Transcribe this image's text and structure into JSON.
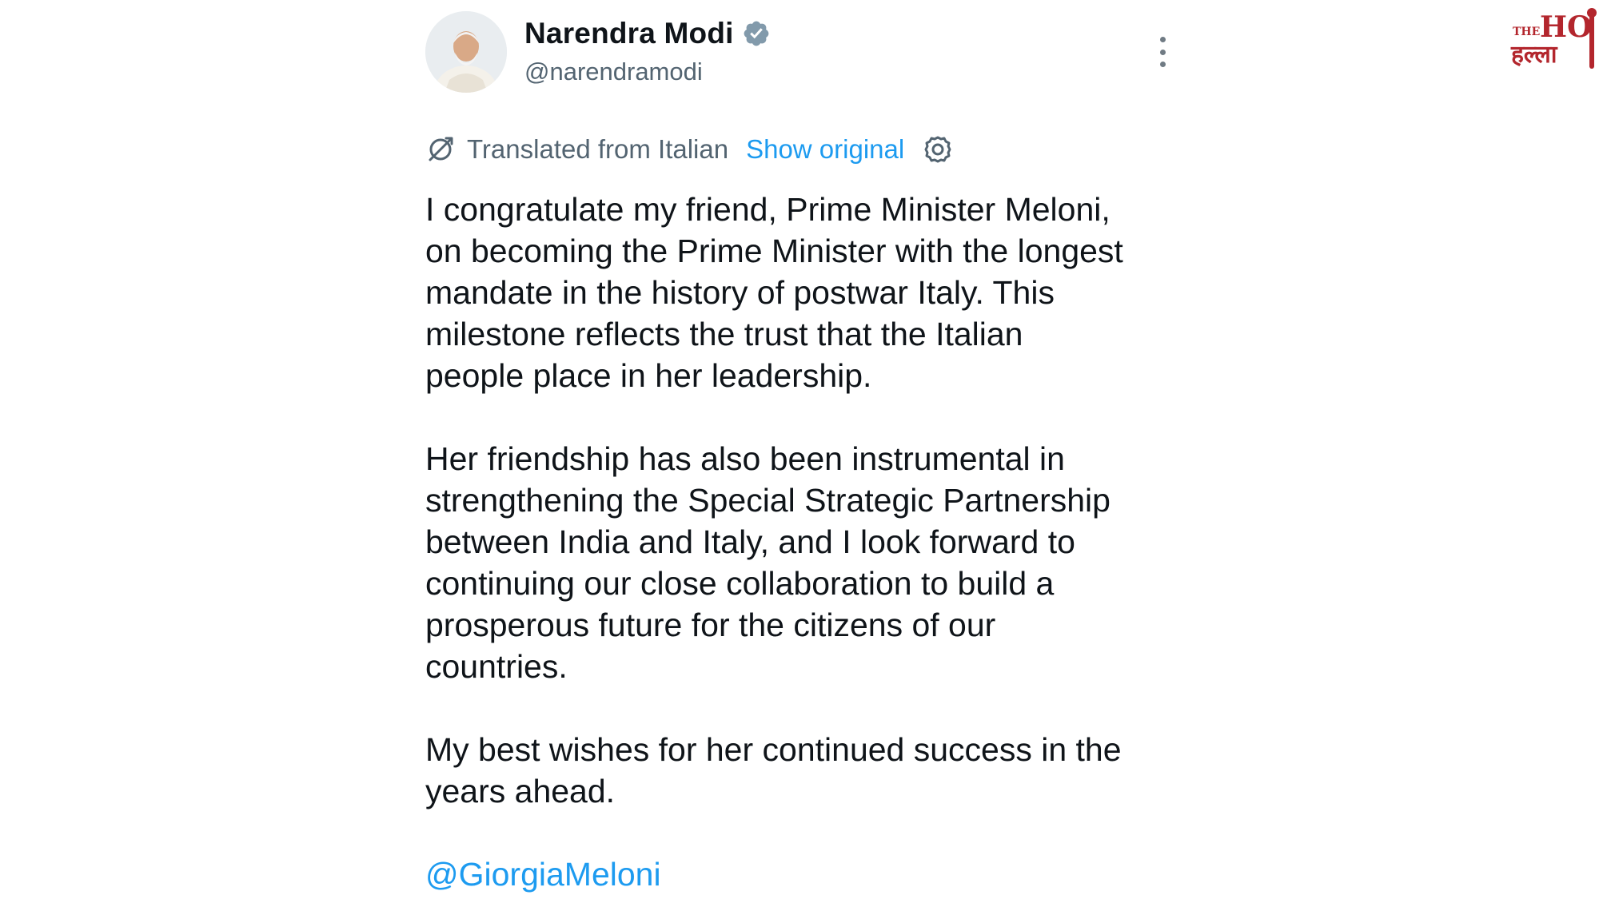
{
  "author": {
    "display_name": "Narendra Modi",
    "handle": "@narendramodi",
    "verified": true,
    "avatar_icon": "profile-photo"
  },
  "translation": {
    "label": "Translated from Italian",
    "show_original": "Show original",
    "icon": "translate-icon",
    "settings_icon": "gear-icon"
  },
  "tweet": {
    "paragraphs": [
      "I congratulate my friend, Prime Minister Meloni,\non becoming the Prime Minister with the longest\nmandate in the history of postwar Italy. This\nmilestone reflects the trust that the Italian\npeople place in her leadership.",
      "Her friendship has also been instrumental in\nstrengthening the Special Strategic Partnership\nbetween India and Italy, and I look forward to\ncontinuing our close collaboration to build a\nprosperous future for the citizens of our\ncountries.",
      "My best wishes for her continued success in the\nyears ahead."
    ],
    "mention": "@GiorgiaMeloni"
  },
  "watermark": {
    "top": "THE HO",
    "bottom": "हल्ला"
  },
  "colors": {
    "link": "#1d9bf0",
    "secondary_text": "#536471",
    "primary_text": "#0f1419",
    "verified_badge": "#829aab",
    "watermark": "#b3262d"
  }
}
